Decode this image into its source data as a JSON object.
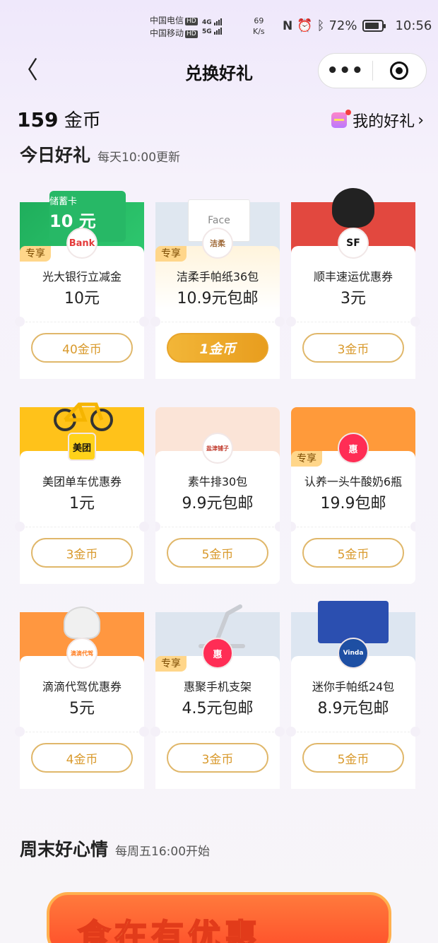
{
  "status": {
    "carrier1": "中国电信",
    "carrier2": "中国移动",
    "hd": "HD",
    "net1": "4G",
    "net2": "5G",
    "speed": "69",
    "speed_unit": "K/s",
    "battery": "72%",
    "time": "10:56"
  },
  "nav": {
    "back": "〈",
    "title": "兑换好礼",
    "more": "•••"
  },
  "header": {
    "coins_value": "159",
    "coins_unit": "金币",
    "my_gifts": "我的好礼",
    "chevron": "›"
  },
  "today": {
    "title": "今日好礼",
    "subtitle": "每天10:00更新"
  },
  "weekend": {
    "title": "周末好心情",
    "subtitle": "每周五16:00开始",
    "banner_text": "食在有优惠"
  },
  "cards": [
    {
      "name": "光大银行立减金",
      "price": "10元",
      "button": "40金币",
      "tag": "专享",
      "logo": "Bank",
      "top_label": "储蓄卡",
      "top_value": "10 元"
    },
    {
      "name": "洁柔手帕纸36包",
      "price": "10.9元包邮",
      "button": "1金币",
      "tag": "专享",
      "logo": "洁柔",
      "box_label": "Face"
    },
    {
      "name": "顺丰速运优惠券",
      "price": "3元",
      "button": "3金币",
      "tag": "",
      "logo": "SF"
    },
    {
      "name": "美团单车优惠券",
      "price": "1元",
      "button": "3金币",
      "tag": "",
      "logo": "美团"
    },
    {
      "name": "素牛排30包",
      "price": "9.9元包邮",
      "button": "5金币",
      "tag": "",
      "logo": "盐津铺子"
    },
    {
      "name": "认养一头牛酸奶6瓶",
      "price": "19.9包邮",
      "button": "5金币",
      "tag": "专享",
      "logo": "惠"
    },
    {
      "name": "滴滴代驾优惠券",
      "price": "5元",
      "button": "4金币",
      "tag": "",
      "logo": "滴滴代驾"
    },
    {
      "name": "惠聚手机支架",
      "price": "4.5元包邮",
      "button": "3金币",
      "tag": "专享",
      "logo": "惠"
    },
    {
      "name": "迷你手帕纸24包",
      "price": "8.9元包邮",
      "button": "5金币",
      "tag": "",
      "logo": "Vinda"
    }
  ],
  "colors": {
    "accent_gold": "#e0b76a",
    "gold_button": "#f2b638",
    "tag_bg": "#ffd68a"
  }
}
